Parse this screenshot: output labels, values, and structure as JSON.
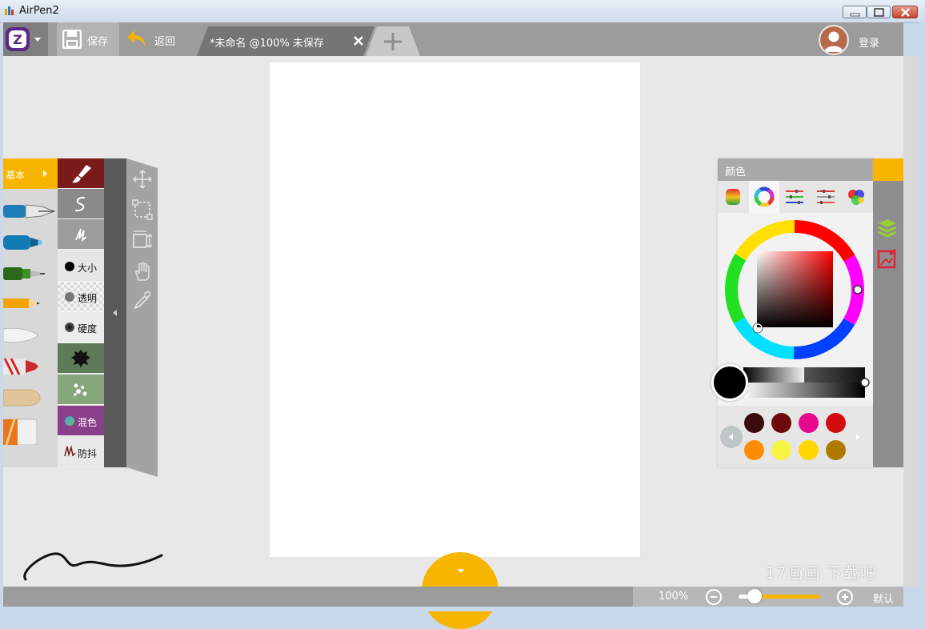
{
  "window": {
    "title": "AirPen2",
    "minimize_label": "",
    "maximize_label": "",
    "close_label": ""
  },
  "toolbar": {
    "save_label": "保存",
    "back_label": "返回",
    "tab_title": "*未命名 @100% 未保存",
    "login_label": "登录"
  },
  "brush_panel": {
    "category_label": "基本",
    "brushes": [
      "fountain-pen",
      "marker",
      "brush-pen",
      "pencil",
      "flat-brush",
      "crayon",
      "wood-tool",
      "eraser"
    ]
  },
  "properties": {
    "size_label": "大小",
    "opacity_label": "透明",
    "hardness_label": "硬度",
    "mix_label": "混色",
    "stabilizer_label": "防抖"
  },
  "color_panel": {
    "title": "颜色",
    "current_color": "#000000",
    "tabs": [
      "gradient-swatch-icon",
      "color-wheel-icon",
      "rgb-sliders-icon",
      "hsv-sliders-icon",
      "color-mixer-icon",
      "palette-wheel-icon"
    ],
    "swatches": [
      "#3b0a0a",
      "#6e0a0a",
      "#e6088c",
      "#d30d0d",
      "#ff8c00",
      "#f5f542",
      "#ffd700",
      "#b07a00"
    ]
  },
  "status": {
    "zoom": "100%",
    "zoom_slider_fraction": 0.2,
    "default_label": "默认"
  },
  "watermark": "17画画 下载吧",
  "colors": {
    "accent": "#f7b500",
    "toolbar": "#9c9c9c",
    "workspace": "#e8e8e8"
  }
}
